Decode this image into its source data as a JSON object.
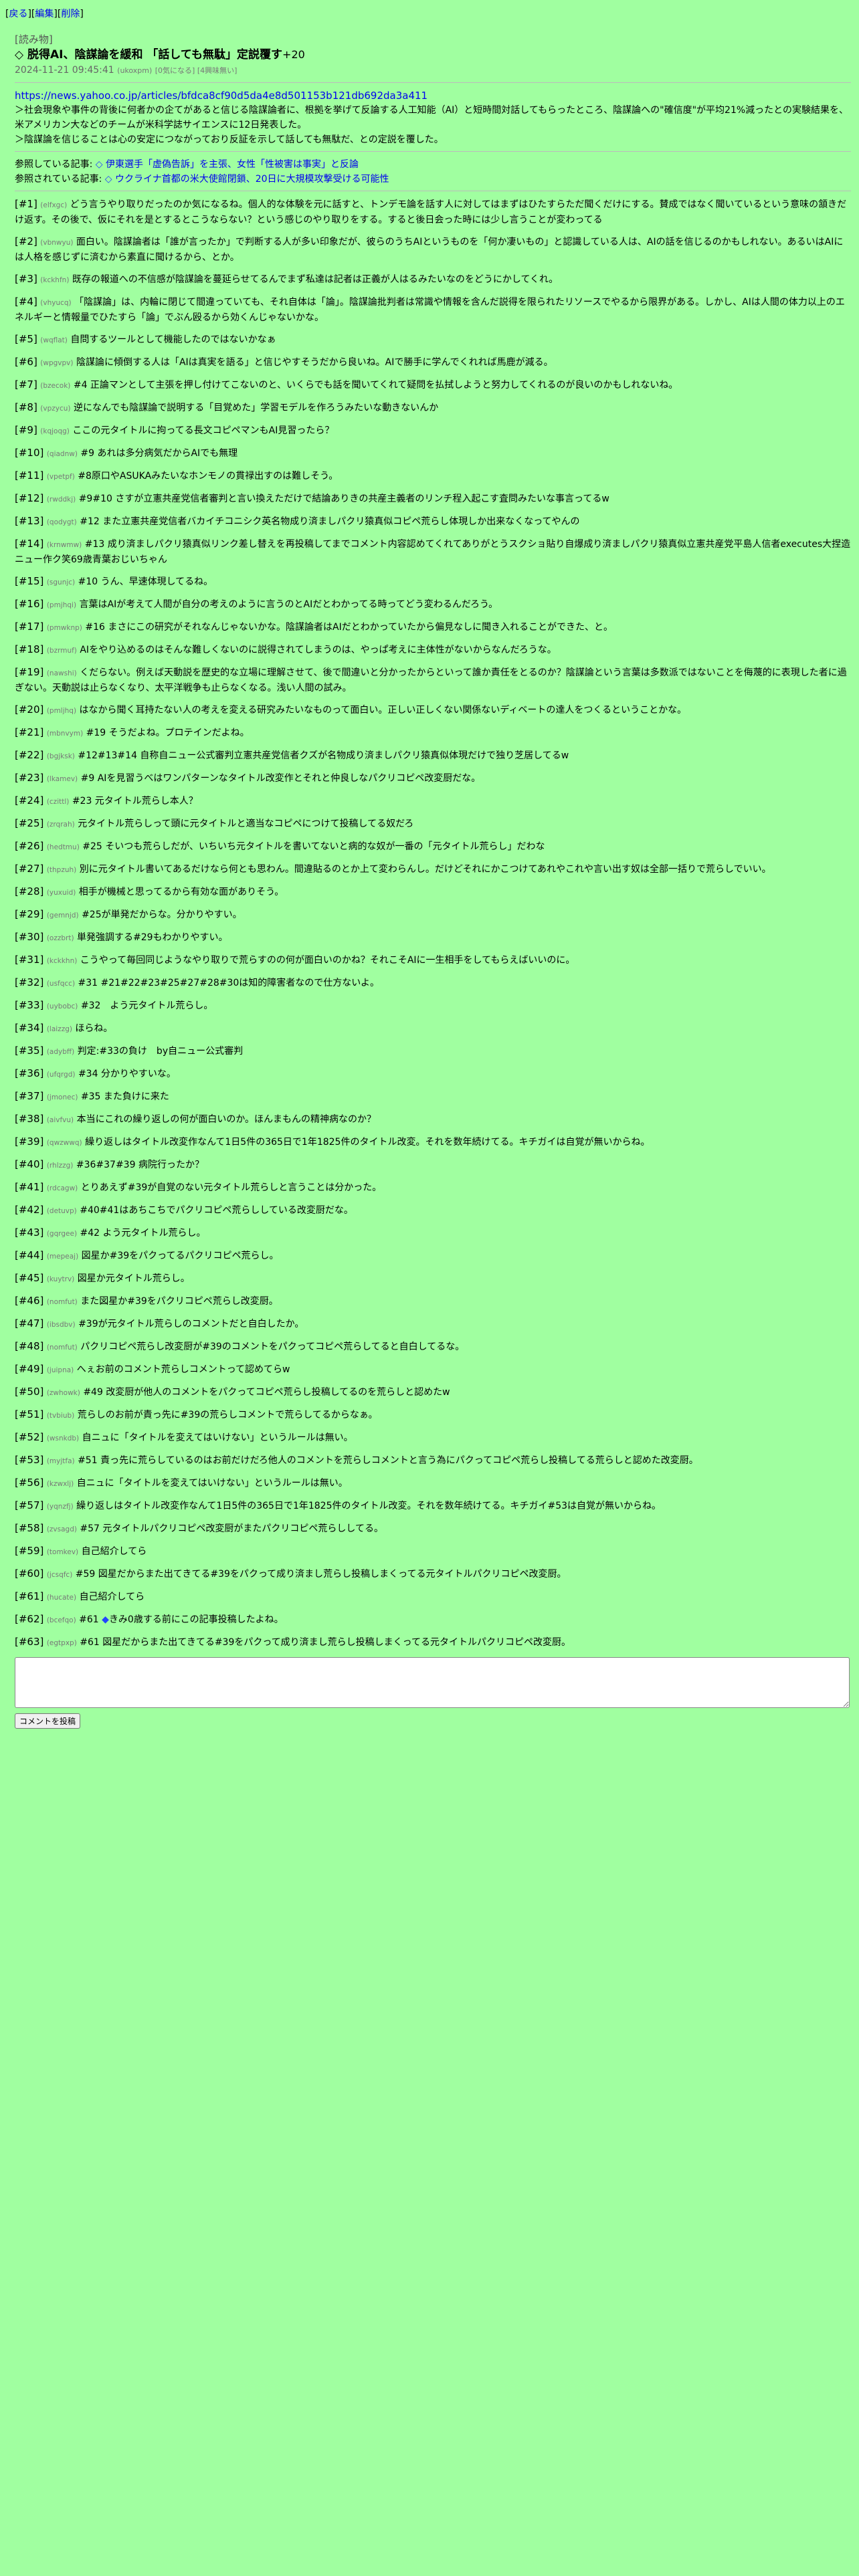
{
  "nav": {
    "open": "[",
    "back": "戻る",
    "sep1": "][",
    "edit": "編集",
    "sep2": "][",
    "delete": "削除",
    "close": "]"
  },
  "article": {
    "category": "[読み物]",
    "diamond": "◇",
    "title": "脱得AI、陰謀論を緩和 「話しても無駄」定説覆す",
    "score": "+20",
    "datetime": "2024-11-21 09:45:41",
    "author": "(ukoxpm)",
    "tags": "[0気になる] [4興味無い]",
    "source_url": "https://news.yahoo.co.jp/articles/bfdca8cf90d5da4e8d501153b121db692da3a411",
    "summary": [
      "＞社会現象や事件の背後に何者かの企てがあると信じる陰謀論者に、根拠を挙げて反論する人工知能（AI）と短時間対話してもらったところ、陰謀論への\"確信度\"が平均21%減ったとの実験結果を、米アメリカン大などのチームが米科学誌サイエンスに12日発表した。",
      "＞陰謀論を信じることは心の安定につながっており反証を示して話しても無駄だ、との定説を覆した。"
    ],
    "refs": [
      {
        "label": "参照している記事:",
        "diamond": "◇",
        "link": "伊東選手「虚偽告訴」を主張、女性「性被害は事実」と反論"
      },
      {
        "label": "参照されている記事:",
        "diamond": "◇",
        "link": "ウクライナ首都の米大使館閉鎖、20日に大規模攻撃受ける可能性"
      }
    ]
  },
  "comments": [
    {
      "num": "[#1]",
      "id": "(elfxgc)",
      "text": "どう言うやり取りだったのか気になるね。個人的な体験を元に話すと、トンデモ論を話す人に対してはまずはひたすらただ聞くだけにする。賛成ではなく聞いているという意味の頷きだけ返す。その後で、仮にそれを是とするとこうならない？という感じのやり取りをする。すると後日会った時には少し言うことが変わってる"
    },
    {
      "num": "[#2]",
      "id": "(vbnwyu)",
      "text": "面白い。陰謀論者は「誰が言ったか」で判断する人が多い印象だが、彼らのうちAIというものを「何か凄いもの」と認識している人は、AIの話を信じるのかもしれない。あるいはAIには人格を感じずに済むから素直に聞けるから、とか。"
    },
    {
      "num": "[#3]",
      "id": "(kckhfn)",
      "text": "既存の報道への不信感が陰謀論を蔓延らせてるんでまず私達は記者は正義が人はるみたいなのをどうにかしてくれ。"
    },
    {
      "num": "[#4]",
      "id": "(vhyucq)",
      "text": "「陰謀論」は、内輪に閉じて間違っていても、それ自体は「論」。陰謀論批判者は常識や情報を含んだ説得を限られたリソースでやるから限界がある。しかし、AIは人間の体力以上のエネルギーと情報量でひたすら「論」でぶん殴るから効くんじゃないかな。"
    },
    {
      "num": "[#5]",
      "id": "(wqflat)",
      "text": "自問するツールとして機能したのではないかなぁ"
    },
    {
      "num": "[#6]",
      "id": "(wpgvpv)",
      "text": "陰謀論に傾倒する人は「AIは真実を語る」と信じやすそうだから良いね。AIで勝手に学んでくれれば馬鹿が減る。"
    },
    {
      "num": "[#7]",
      "id": "(bzecok)",
      "text": "#4 正論マンとして主張を押し付けてこないのと、いくらでも話を聞いてくれて疑問を払拭しようと努力してくれるのが良いのかもしれないね。"
    },
    {
      "num": "[#8]",
      "id": "(vpzycu)",
      "text": "逆になんでも陰謀論で説明する「目覚めた」学習モデルを作ろうみたいな動きないんか"
    },
    {
      "num": "[#9]",
      "id": "(kqjoqg)",
      "text": "ここの元タイトルに拘ってる長文コピペマンもAI見習ったら？"
    },
    {
      "num": "[#10]",
      "id": "(qiadnw)",
      "text": "#9 あれは多分病気だからAIでも無理"
    },
    {
      "num": "[#11]",
      "id": "(vpetpf)",
      "text": "#8原口やASUKAみたいなホンモノの貫禄出すのは難しそう。"
    },
    {
      "num": "[#12]",
      "id": "(rwddkj)",
      "text": "#9#10 さすが立憲共産党信者審判と言い換えただけで結論ありきの共産主義者のリンチ程入起こす査問みたいな事言ってるw"
    },
    {
      "num": "[#13]",
      "id": "(qodygt)",
      "text": "#12 また立憲共産党信者バカイチコニシク英名物成り済ましパクリ猿真似コピペ荒らし体現しか出来なくなってやんの"
    },
    {
      "num": "[#14]",
      "id": "(krnwmw)",
      "text": "#13 成り済ましパクリ猿真似リンク差し替えを再投稿してまでコメント内容認めてくれてありがとうスクショ貼り自爆成り済ましパクリ猿真似立憲共産党平島人信者executes大捏造ニュー作ク笑69歳青葉おじいちゃん"
    },
    {
      "num": "[#15]",
      "id": "(sgunjc)",
      "text": "#10 うん、早速体現してるね。"
    },
    {
      "num": "[#16]",
      "id": "(pmjhqi)",
      "text": "言葉はAIが考えて人間が自分の考えのように言うのとAIだとわかってる時ってどう変わるんだろう。"
    },
    {
      "num": "[#17]",
      "id": "(pmwknp)",
      "text": "#16 まさにこの研究がそれなんじゃないかな。陰謀論者はAIだとわかっていたから偏見なしに聞き入れることができた、と。"
    },
    {
      "num": "[#18]",
      "id": "(bzrmuf)",
      "text": "AIをやり込めるのはそんな難しくないのに説得されてしまうのは、やっぱ考えに主体性がないからなんだろうな。"
    },
    {
      "num": "[#19]",
      "id": "(nawshi)",
      "text": "くだらない。例えば天動説を歴史的な立場に理解させて、後で間違いと分かったからといって誰か責任をとるのか？陰謀論という言葉は多数派ではないことを侮蔑的に表現した者に過ぎない。天動説は止らなくなり、太平洋戦争も止らなくなる。浅い人間の試み。"
    },
    {
      "num": "[#20]",
      "id": "(pmljhq)",
      "text": "はなから聞く耳持たない人の考えを変える研究みたいなものって面白い。正しい正しくない関係ないディベートの達人をつくるということかな。"
    },
    {
      "num": "[#21]",
      "id": "(mbnvym)",
      "text": "#19 そうだよね。プロテインだよね。"
    },
    {
      "num": "[#22]",
      "id": "(bgjksk)",
      "text": "#12#13#14 自称自ニュー公式審判立憲共産党信者クズが名物成り済ましパクリ猿真似体現だけで独り芝居してるw"
    },
    {
      "num": "[#23]",
      "id": "(lkamev)",
      "text": "#9 AIを見習うべはワンパターンなタイトル改変作とそれと仲良しなパクリコピペ改変厨だな。"
    },
    {
      "num": "[#24]",
      "id": "(czittl)",
      "text": "#23 元タイトル荒らし本人？"
    },
    {
      "num": "[#25]",
      "id": "(zrqrah)",
      "text": "元タイトル荒らしって頭に元タイトルと適当なコピペにつけて投稿してる奴だろ"
    },
    {
      "num": "[#26]",
      "id": "(hedtmu)",
      "text": "#25 そいつも荒らしだが、いちいち元タイトルを書いてないと病的な奴が一番の「元タイトル荒らし」だわな"
    },
    {
      "num": "[#27]",
      "id": "(thpzuh)",
      "text": "別に元タイトル書いてあるだけなら何とも思わん。間違貼るのとか上て変わらんし。だけどそれにかこつけてあれやこれや言い出す奴は全部一括りで荒らしでいい。"
    },
    {
      "num": "[#28]",
      "id": "(yuxuid)",
      "text": "相手が機械と思ってるから有効な面がありそう。"
    },
    {
      "num": "[#29]",
      "id": "(gemnjd)",
      "text": "#25が単発だからな。分かりやすい。"
    },
    {
      "num": "[#30]",
      "id": "(ozzbrt)",
      "text": "単発強調する#29もわかりやすい。"
    },
    {
      "num": "[#31]",
      "id": "(kckkhn)",
      "text": "こうやって毎回同じようなやり取りで荒らすのの何が面白いのかね？それこそAIに一生相手をしてもらえばいいのに。"
    },
    {
      "num": "[#32]",
      "id": "(usfqcc)",
      "text": "#31 #21#22#23#25#27#28#30は知的障害者なので仕方ないよ。"
    },
    {
      "num": "[#33]",
      "id": "(uybobc)",
      "text": "#32　よう元タイトル荒らし。"
    },
    {
      "num": "[#34]",
      "id": "(laizzg)",
      "text": "ほらね。"
    },
    {
      "num": "[#35]",
      "id": "(adybff)",
      "text": "判定:#33の負け　by自ニュー公式審判"
    },
    {
      "num": "[#36]",
      "id": "(ufqrgd)",
      "text": "#34 分かりやすいな。"
    },
    {
      "num": "[#37]",
      "id": "(jmonec)",
      "text": "#35 また負けに来た"
    },
    {
      "num": "[#38]",
      "id": "(aivfvu)",
      "text": "本当にこれの繰り返しの何が面白いのか。ほんまもんの精神病なのか？"
    },
    {
      "num": "[#39]",
      "id": "(qwzwwq)",
      "text": "繰り返しはタイトル改変作なんて1日5件の365日で1年1825件のタイトル改変。それを数年続けてる。キチガイは自覚が無いからね。"
    },
    {
      "num": "[#40]",
      "id": "(rhlzzg)",
      "text": "#36#37#39 病院行ったか？"
    },
    {
      "num": "[#41]",
      "id": "(rdcagw)",
      "text": "とりあえず#39が自覚のない元タイトル荒らしと言うことは分かった。"
    },
    {
      "num": "[#42]",
      "id": "(detuvp)",
      "text": "#40#41はあちこちでパクリコピペ荒らししている改変厨だな。"
    },
    {
      "num": "[#43]",
      "id": "(gqrgee)",
      "text": "#42 よう元タイトル荒らし。"
    },
    {
      "num": "[#44]",
      "id": "(mepeaj)",
      "text": "図星か#39をパクってるパクリコピペ荒らし。"
    },
    {
      "num": "[#45]",
      "id": "(kuytrv)",
      "text": "図星か元タイトル荒らし。"
    },
    {
      "num": "[#46]",
      "id": "(nomfut)",
      "text": "また図星か#39をパクリコピペ荒らし改変厨。"
    },
    {
      "num": "[#47]",
      "id": "(ibsdbv)",
      "text": "#39が元タイトル荒らしのコメントだと自白したか。"
    },
    {
      "num": "[#48]",
      "id": "(nomfut)",
      "text": "パクリコピペ荒らし改変厨が#39のコメントをパクってコピペ荒らしてると自白してるな。"
    },
    {
      "num": "[#49]",
      "id": "(juipna)",
      "text": "へぇお前のコメント荒らしコメントって認めてらw"
    },
    {
      "num": "[#50]",
      "id": "(zwhowk)",
      "text": "#49 改変厨が他人のコメントをパクってコピペ荒らし投稿してるのを荒らしと認めたw"
    },
    {
      "num": "[#51]",
      "id": "(tvbiub)",
      "text": "荒らしのお前が責っ先に#39の荒らしコメントで荒らしてるからなぁ。"
    },
    {
      "num": "[#52]",
      "id": "(wsnkdb)",
      "text": "自ニュに「タイトルを変えてはいけない」というルールは無い。"
    },
    {
      "num": "[#53]",
      "id": "(myjtfa)",
      "text": "#51 責っ先に荒らしているのはお前だけだろ他人のコメントを荒らしコメントと言う為にパクってコピペ荒らし投稿してる荒らしと認めた改変厨。"
    },
    {
      "num": "[#56]",
      "id": "(kzwxlj)",
      "text": "自ニュに「タイトルを変えてはいけない」というルールは無い。"
    },
    {
      "num": "[#57]",
      "id": "(yqnzfj)",
      "text": "繰り返しはタイトル改変作なんて1日5件の365日で1年1825件のタイトル改変。それを数年続けてる。キチガイ#53は自覚が無いからね。"
    },
    {
      "num": "[#58]",
      "id": "(zvsagd)",
      "text": "#57 元タイトルパクリコピペ改変厨がまたパクリコピペ荒らししてる。"
    },
    {
      "num": "[#59]",
      "id": "(tomkev)",
      "text": "自己紹介してら"
    },
    {
      "num": "[#60]",
      "id": "(jcsqfc)",
      "text": "#59 図星だからまた出てきてる#39をパクって成り済まし荒らし投稿しまくってる元タイトルパクリコピペ改変厨。"
    },
    {
      "num": "[#61]",
      "id": "(hucate)",
      "text": "自己紹介してら"
    },
    {
      "num": "[#62]",
      "id": "(bcefqo)",
      "pre": "#61 ",
      "diamond": "◆",
      "text": "きみ0歳する前にこの記事投稿したよね。"
    },
    {
      "num": "[#63]",
      "id": "(egtpxp)",
      "text": "#61 図星だからまた出てきてる#39をパクって成り済まし荒らし投稿しまくってる元タイトルパクリコピペ改変厨。"
    }
  ],
  "form": {
    "post_button": "コメントを投稿"
  },
  "colors": {
    "background": "#a0ffa0",
    "link": "#0000ee",
    "meta": "#666666",
    "diamond": "#2244ff"
  }
}
